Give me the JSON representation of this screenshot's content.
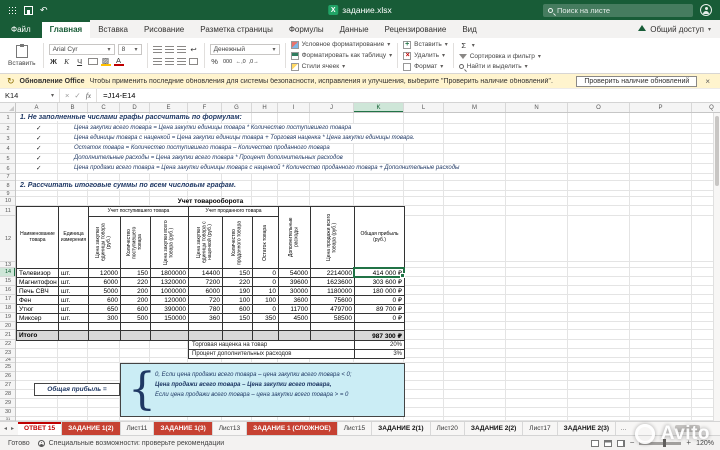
{
  "titlebar": {
    "filename": "задание.xlsx",
    "search_placeholder": "Поиск на листе"
  },
  "ribbon": {
    "file_tab": "Файл",
    "tabs": [
      "Главная",
      "Вставка",
      "Рисование",
      "Разметка страницы",
      "Формулы",
      "Данные",
      "Рецензирование",
      "Вид"
    ],
    "active_tab": "Главная",
    "share_label": "Общий доступ",
    "paste_label": "Вставить",
    "font_name": "Arial Cyr",
    "font_size": "8",
    "bold": "Ж",
    "italic": "К",
    "underline": "Ч",
    "sum_icon": "Σ",
    "percent_icon": "%",
    "number_format": "Денежный",
    "styles": [
      "Условное форматирование",
      "Форматировать как таблицу",
      "Стили ячеек"
    ],
    "cells": [
      "Вставить",
      "Удалить",
      "Формат"
    ],
    "editing": [
      "Сортировка и фильтр",
      "Найти и выделить"
    ]
  },
  "msgbar": {
    "title": "Обновление Office",
    "message": "Чтобы применить последние обновления для системы безопасности, исправления и улучшения, выберите \"Проверить наличие обновлений\".",
    "button": "Проверить наличие обновлений",
    "close": "×"
  },
  "formula_bar": {
    "cell_ref": "K14",
    "fx": "fx",
    "cancel": "×",
    "enter": "✓",
    "formula": "=J14-E14"
  },
  "grid": {
    "columns": [
      "A",
      "B",
      "C",
      "D",
      "E",
      "F",
      "G",
      "H",
      "I",
      "J",
      "K",
      "L",
      "M",
      "N",
      "O",
      "P",
      "Q"
    ],
    "row_count": 31,
    "selected_cell": "K14",
    "selected_column": "K",
    "selected_row": 14
  },
  "content": {
    "task1": "1. Не заполненные числами графы рассчитать по формулам:",
    "check_char": "✓",
    "formulas": [
      "Цена закупки всего товара = Цена закупки единицы товара * Количество поступившего товара",
      "Цена единицы товара с наценкой = Цена закупки единицы товара + Торговая наценка * Цена закупки единицы товара.",
      "Остаток товара = Количество поступившего товара – Количество проданного товара",
      "Дополнительные расходы = Цена закупки всего товара * Процент дополнительных расходов",
      "Цена продажи всего товара = Цена закупки единицы товара с наценкой * Количество проданного товара + Дополнительные расходы"
    ],
    "task2": "2. Рассчитать итоговые суммы по всем числовым графам.",
    "table": {
      "title": "Учет товарооборота",
      "col1": "Наименование товара",
      "col2": "Единица измерения",
      "group1": "Учет поступившего товара",
      "group2": "Учет проданного товара",
      "rot_headers": [
        "Цена закупки единицы товара (руб.)",
        "Количество поступившего товара",
        "Цена закупки всего товара (руб.)",
        "Цена закупки единицы товара с наценкой (руб.)",
        "Количество проданного товара",
        "Остаток товара",
        "Дополнительные расходы",
        "Цена продажи всего товара (руб.)"
      ],
      "col_last": "Общая прибыль (руб.)",
      "rows": [
        [
          "Телевизор",
          "шт.",
          "12000",
          "150",
          "1800000",
          "14400",
          "150",
          "0",
          "54000",
          "2214000",
          "414 000 ₽"
        ],
        [
          "Магнитофон",
          "шт.",
          "6000",
          "220",
          "1320000",
          "7200",
          "220",
          "0",
          "39600",
          "1623600",
          "303 600 ₽"
        ],
        [
          "Печь СВЧ",
          "шт.",
          "5000",
          "200",
          "1000000",
          "6000",
          "190",
          "10",
          "30000",
          "1180000",
          "180 000 ₽"
        ],
        [
          "Фен",
          "шт.",
          "600",
          "200",
          "120000",
          "720",
          "100",
          "100",
          "3600",
          "75600",
          "0 ₽"
        ],
        [
          "Утюг",
          "шт.",
          "650",
          "600",
          "390000",
          "780",
          "600",
          "0",
          "11700",
          "479700",
          "89 700 ₽"
        ],
        [
          "Миксер",
          "шт.",
          "300",
          "500",
          "150000",
          "360",
          "150",
          "350",
          "4500",
          "58500",
          "0 ₽"
        ]
      ],
      "total_label": "Итого",
      "total_value": "987 300 ₽"
    },
    "params": [
      {
        "label": "Торговая наценка на товар",
        "value": "20%"
      },
      {
        "label": "Процент дополнительных расходов",
        "value": "3%"
      }
    ],
    "profit_label": "Общая прибыль =",
    "brace": "{",
    "profit_rule": [
      "0, Если цена продажи всего товара – цена закупки всего товара < 0;",
      "Цена продажи всего товара – Цена закупки всего товара,",
      "Если цена продажи всего товара – цена закупки всего товара > = 0"
    ]
  },
  "sheet_tabs": {
    "tabs": [
      {
        "label": "ОТВЕТ 15",
        "style": "activered"
      },
      {
        "label": "ЗАДАНИЕ 1(2)",
        "style": "red"
      },
      {
        "label": "Лист11",
        "style": "plain"
      },
      {
        "label": "ЗАДАНИЕ 1(3)",
        "style": "red"
      },
      {
        "label": "Лист13",
        "style": "plain"
      },
      {
        "label": "ЗАДАНИЕ 1 (СЛОЖНОЕ)",
        "style": "red"
      },
      {
        "label": "Лист15",
        "style": "plain"
      },
      {
        "label": "ЗАДАНИЕ 2(1)",
        "style": "boldtab"
      },
      {
        "label": "Лист20",
        "style": "plain"
      },
      {
        "label": "ЗАДАНИЕ 2(2)",
        "style": "boldtab"
      },
      {
        "label": "Лист17",
        "style": "plain"
      },
      {
        "label": "ЗАДАНИЕ 2(3)",
        "style": "boldtab"
      }
    ]
  },
  "status_bar": {
    "ready": "Готово",
    "accessibility": "Специальные возможности: проверьте рекомендации",
    "zoom": "120%"
  },
  "watermark": "Avito"
}
